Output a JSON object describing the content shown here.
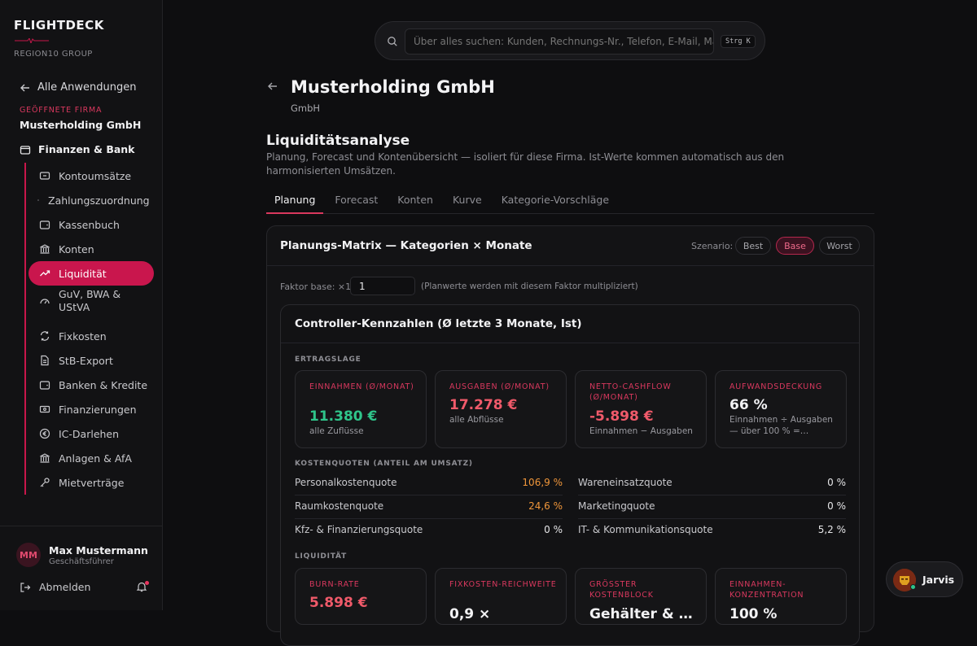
{
  "app": {
    "brand": "FLIGHTDECK",
    "group": "REGION10 GROUP"
  },
  "sidebar": {
    "back_label": "Alle Anwendungen",
    "open_company_label": "GEÖFFNETE FIRMA",
    "open_company_name": "Musterholding GmbH",
    "section_label": "Finanzen & Bank",
    "items": [
      {
        "label": "Kontoumsätze",
        "icon": "bank-card-icon"
      },
      {
        "label": "Zahlungszuordnung",
        "icon": "dot-icon"
      },
      {
        "label": "Kassenbuch",
        "icon": "wallet-icon"
      },
      {
        "label": "Konten",
        "icon": "bank-icon"
      },
      {
        "label": "Liquidität",
        "icon": "trend-up-icon",
        "active": true
      },
      {
        "label": "GuV, BWA & UStVA",
        "icon": "gauge-icon"
      },
      {
        "label": "Fixkosten",
        "icon": "repeat-icon"
      },
      {
        "label": "StB-Export",
        "icon": "document-icon"
      },
      {
        "label": "Banken & Kredite",
        "icon": "wallet-icon"
      },
      {
        "label": "Finanzierungen",
        "icon": "banknote-icon"
      },
      {
        "label": "IC-Darlehen",
        "icon": "euro-icon"
      },
      {
        "label": "Anlagen & AfA",
        "icon": "building-icon"
      },
      {
        "label": "Mietverträge",
        "icon": "key-icon"
      }
    ],
    "user": {
      "initials": "MM",
      "name": "Max Mustermann",
      "role": "Geschäftsführer"
    },
    "logout_label": "Abmelden"
  },
  "search": {
    "placeholder": "Über alles suchen: Kunden, Rechnungs-Nr., Telefon, E-Mail, Mail-Inhalte …",
    "shortcut": "Strg K"
  },
  "page": {
    "title": "Musterholding GmbH",
    "subtitle": "GmbH",
    "section_title": "Liquiditätsanalyse",
    "description": "Planung, Forecast und Kontenübersicht — isoliert für diese Firma. Ist-Werte kommen automatisch aus den harmonisierten Umsätzen.",
    "tabs": [
      "Planung",
      "Forecast",
      "Konten",
      "Kurve",
      "Kategorie-Vorschläge"
    ],
    "active_tab": "Planung"
  },
  "matrix": {
    "title": "Planungs-Matrix — Kategorien × Monate",
    "scenario_label": "Szenario:",
    "scenarios": [
      "Best",
      "Base",
      "Worst"
    ],
    "active_scenario": "Base",
    "factor_label": "Faktor base: ×1",
    "factor_value": "1",
    "factor_note": "(Planwerte werden mit diesem Faktor multipliziert)"
  },
  "controller": {
    "title": "Controller-Kennzahlen (Ø letzte 3 Monate, Ist)",
    "ertragslage_label": "ERTRAGSLAGE",
    "kpis": [
      {
        "label": "EINNAHMEN (Ø/MONAT)",
        "value": "11.380 €",
        "note": "alle Zuflüsse",
        "tone": "green"
      },
      {
        "label": "AUSGABEN (Ø/MONAT)",
        "value": "17.278 €",
        "note": "alle Abflüsse",
        "tone": "red"
      },
      {
        "label": "NETTO-CASHFLOW (Ø/MONAT)",
        "value": "-5.898 €",
        "note": "Einnahmen − Ausgaben",
        "tone": "red"
      },
      {
        "label": "AUFWANDSDECKUNG",
        "value": "66 %",
        "note": "Einnahmen ÷ Ausgaben — über 100 % =…",
        "tone": "white"
      }
    ],
    "kostenquoten_label": "KOSTENQUOTEN (ANTEIL AM UMSATZ)",
    "ratios_left": [
      {
        "label": "Personalkostenquote",
        "value": "106,9 %",
        "warn": true
      },
      {
        "label": "Raumkostenquote",
        "value": "24,6 %",
        "warn": true
      },
      {
        "label": "Kfz- & Finanzierungsquote",
        "value": "0 %",
        "warn": false
      }
    ],
    "ratios_right": [
      {
        "label": "Wareneinsatzquote",
        "value": "0 %",
        "warn": false
      },
      {
        "label": "Marketingquote",
        "value": "0 %",
        "warn": false
      },
      {
        "label": "IT- & Kommunikationsquote",
        "value": "5,2 %",
        "warn": false
      }
    ],
    "liquiditaet_label": "LIQUIDITÄT",
    "liq_kpis": [
      {
        "label": "BURN-RATE",
        "value": "5.898 €",
        "tone": "red"
      },
      {
        "label": "FIXKOSTEN-REICHWEITE",
        "value": "0,9 ×",
        "tone": "white"
      },
      {
        "label": "GRÖSSTER KOSTENBLOCK",
        "value": "Gehälter & …",
        "tone": "white"
      },
      {
        "label": "EINNAHMEN-KONZENTRATION",
        "value": "100 %",
        "tone": "white"
      }
    ]
  },
  "assistant": {
    "name": "Jarvis"
  },
  "colors": {
    "accent": "#c9164d",
    "positive": "#2fc48a",
    "negative": "#f05a6a",
    "warning": "#f0963a"
  }
}
